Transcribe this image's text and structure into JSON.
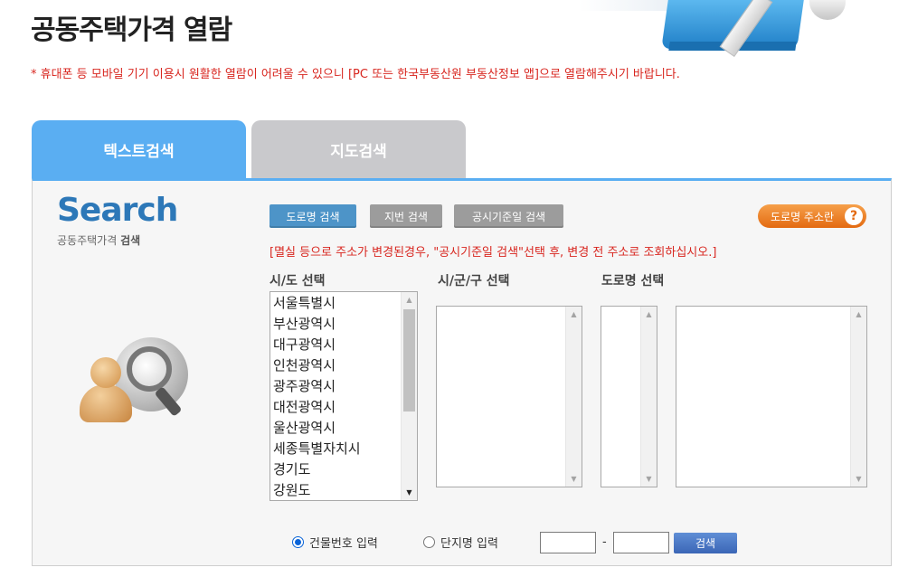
{
  "page": {
    "title": "공동주택가격 열람",
    "notice": "* 휴대폰 등 모바일 기기 이용시 원활한 열람이 어려울 수 있으니 [PC 또는 한국부동산원 부동산정보 앱]으로 열람해주시기 바랍니다."
  },
  "tabs": [
    {
      "label": "텍스트검색",
      "active": true
    },
    {
      "label": "지도검색",
      "active": false
    }
  ],
  "logo": {
    "title": "Search",
    "subtitle_plain": "공동주택가격 ",
    "subtitle_bold": "검색"
  },
  "search_buttons": {
    "road": "도로명 검색",
    "jibun": "지번 검색",
    "date": "공시기준일 검색"
  },
  "help_button": {
    "label": "도로명 주소란",
    "icon": "question-icon",
    "icon_glyph": "?"
  },
  "warning": "[멸실 등으로 주소가 변경된경우, \"공시기준일 검색\"선택 후, 변경 전 주소로 조회하십시오.]",
  "columns": {
    "sido_label": "시/도 선택",
    "sigungu_label": "시/군/구 선택",
    "road_label": "도로명 선택"
  },
  "sido_list": [
    "서울특별시",
    "부산광역시",
    "대구광역시",
    "인천광역시",
    "광주광역시",
    "대전광역시",
    "울산광역시",
    "세종특별자치시",
    "경기도",
    "강원도"
  ],
  "input_mode": {
    "building_number": "건물번호 입력",
    "complex_name": "단지명 입력",
    "selected": "building_number"
  },
  "dash": "-",
  "search_label": "검색",
  "colors": {
    "accent": "#5aaef2",
    "warning": "#d8261f",
    "help": "#e36a11"
  }
}
